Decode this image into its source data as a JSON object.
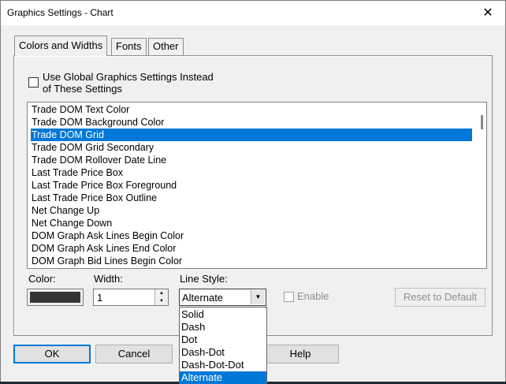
{
  "window": {
    "title": "Graphics Settings  - Chart",
    "close_glyph": "✕"
  },
  "tabs": [
    "Colors and Widths",
    "Fonts",
    "Other"
  ],
  "global_settings": {
    "label_line1": "Use Global Graphics Settings Instead",
    "label_line2": "of These Settings",
    "checked": false
  },
  "list": {
    "items": [
      "Trade DOM Text Color",
      "Trade DOM Background Color",
      "Trade DOM Grid",
      "Trade DOM Grid Secondary",
      "Trade DOM Rollover Date Line",
      "Last Trade Price Box",
      "Last Trade Price Box Foreground",
      "Last Trade Price Box Outline",
      "Net Change Up",
      "Net Change Down",
      "DOM Graph Ask Lines Begin Color",
      "DOM Graph Ask Lines End Color",
      "DOM Graph Bid Lines Begin Color"
    ],
    "selected": "Trade DOM Grid"
  },
  "color": {
    "label": "Color:",
    "value": "#353535"
  },
  "width": {
    "label": "Width:",
    "value": "1"
  },
  "line_style": {
    "label": "Line Style:",
    "value": "Alternate",
    "options": [
      "Solid",
      "Dash",
      "Dot",
      "Dash-Dot",
      "Dash-Dot-Dot",
      "Alternate"
    ]
  },
  "enable": {
    "label": "Enable",
    "checked": false,
    "disabled": true
  },
  "buttons": {
    "reset": "Reset to Default",
    "ok": "OK",
    "cancel": "Cancel",
    "help": "Help"
  },
  "colors": {
    "accent": "#0078d7",
    "dialog_bg": "#f0f0f0"
  }
}
